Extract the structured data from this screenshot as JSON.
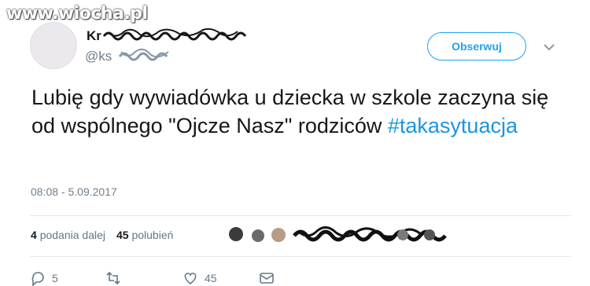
{
  "watermark": "www.wiocha.pl",
  "tweet": {
    "handle_prefix": "@ks",
    "follow_label": "Obserwuj",
    "text_main": "Lubię gdy wywiadówka u dziecka w szkole zaczyna się od wspólnego \"Ojcze Nasz\" rodziców ",
    "hashtag": "#takasytuacja",
    "timestamp": "08:08 - 5.09.2017",
    "stats": {
      "retweets_count": "4",
      "retweets_label": "podania dalej",
      "likes_count": "45",
      "likes_label": "polubień"
    },
    "actions": {
      "reply_count": "5",
      "like_count": "45"
    }
  },
  "colors": {
    "accent": "#1da1f2",
    "hashtag": "#1b95e0",
    "muted": "#707e8c",
    "divider": "#e1e8ed"
  },
  "icons": [
    "chevron-down-icon",
    "reply-icon",
    "retweet-icon",
    "heart-icon",
    "message-icon"
  ]
}
